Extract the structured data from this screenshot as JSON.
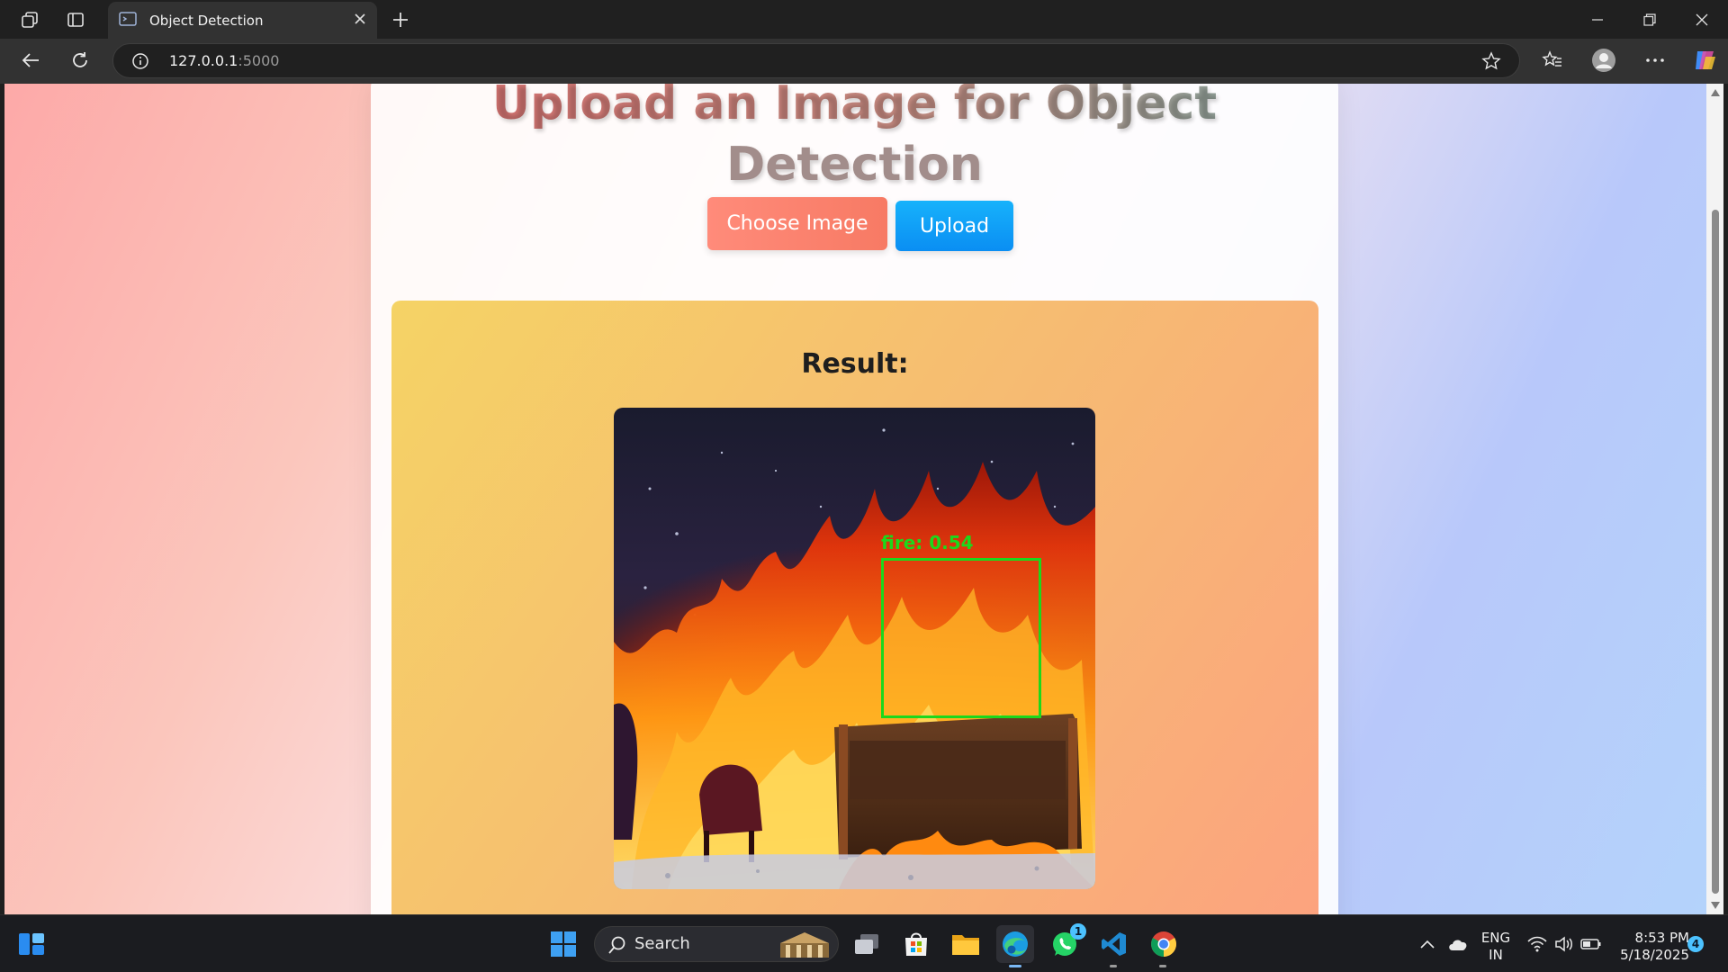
{
  "browser": {
    "tab_title": "Object Detection",
    "url_host": "127.0.0.1",
    "url_port": ":5000"
  },
  "page": {
    "heading_line1": "Upload an Image for Object",
    "heading_line2": "Detection",
    "choose_button": "Choose Image",
    "upload_button": "Upload",
    "result_title": "Result:",
    "detection_label": "fire: 0.54"
  },
  "taskbar": {
    "search_label": "Search",
    "language_line1": "ENG",
    "language_line2": "IN",
    "time": "8:53 PM",
    "date": "5/18/2025",
    "notification_count": "4",
    "whatsapp_badge": "1"
  },
  "colors": {
    "detection_box": "#1cd81c",
    "choose_button": "#f77a64",
    "upload_button": "#0a8ef3"
  }
}
